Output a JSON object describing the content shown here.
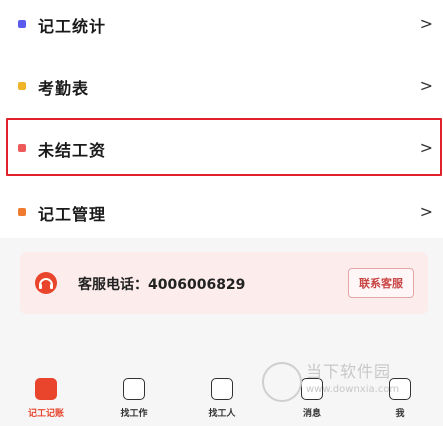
{
  "menu": {
    "items": [
      {
        "label": "记工统计",
        "color": "#5b5bf0",
        "chevron": ">"
      },
      {
        "label": "考勤表",
        "color": "#f0b429",
        "chevron": ">"
      },
      {
        "label": "未结工资",
        "color": "#ee5a5a",
        "chevron": ">"
      },
      {
        "label": "记工管理",
        "color": "#f07a2e",
        "chevron": ">"
      }
    ],
    "selected_index": 2
  },
  "service": {
    "text": "客服电话：4006006829",
    "button_label": "联系客服",
    "icon": "headset-icon"
  },
  "tabbar": {
    "tabs": [
      {
        "label": "记工记账",
        "icon": "ledger-icon",
        "active": true
      },
      {
        "label": "找工作",
        "icon": "briefcase-icon"
      },
      {
        "label": "找工人",
        "icon": "worker-icon"
      },
      {
        "label": "消息",
        "icon": "message-icon"
      },
      {
        "label": "我",
        "icon": "profile-icon"
      }
    ]
  },
  "watermark": {
    "cn": "当下软件园",
    "en": "www.downxia.com"
  }
}
